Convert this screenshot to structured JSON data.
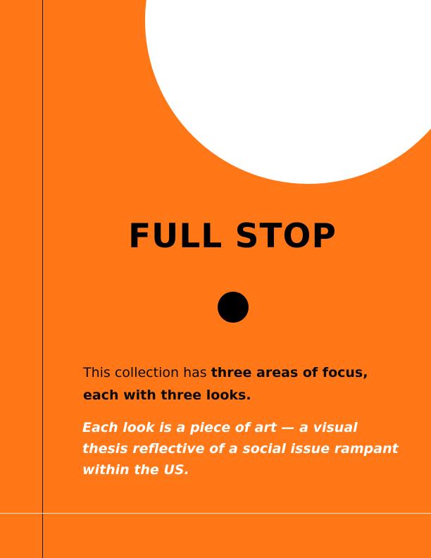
{
  "title": "FULL STOP",
  "intro": {
    "plain": "This collection has ",
    "bold": "three areas of focus, each with three looks."
  },
  "quote": "Each look is a piece of art — a visual thesis reflective of a social issue rampant within the US.",
  "colors": {
    "background": "#FF7716",
    "circle": "#FFFFFF",
    "title": "#000000",
    "quote": "#FFFFFF"
  }
}
